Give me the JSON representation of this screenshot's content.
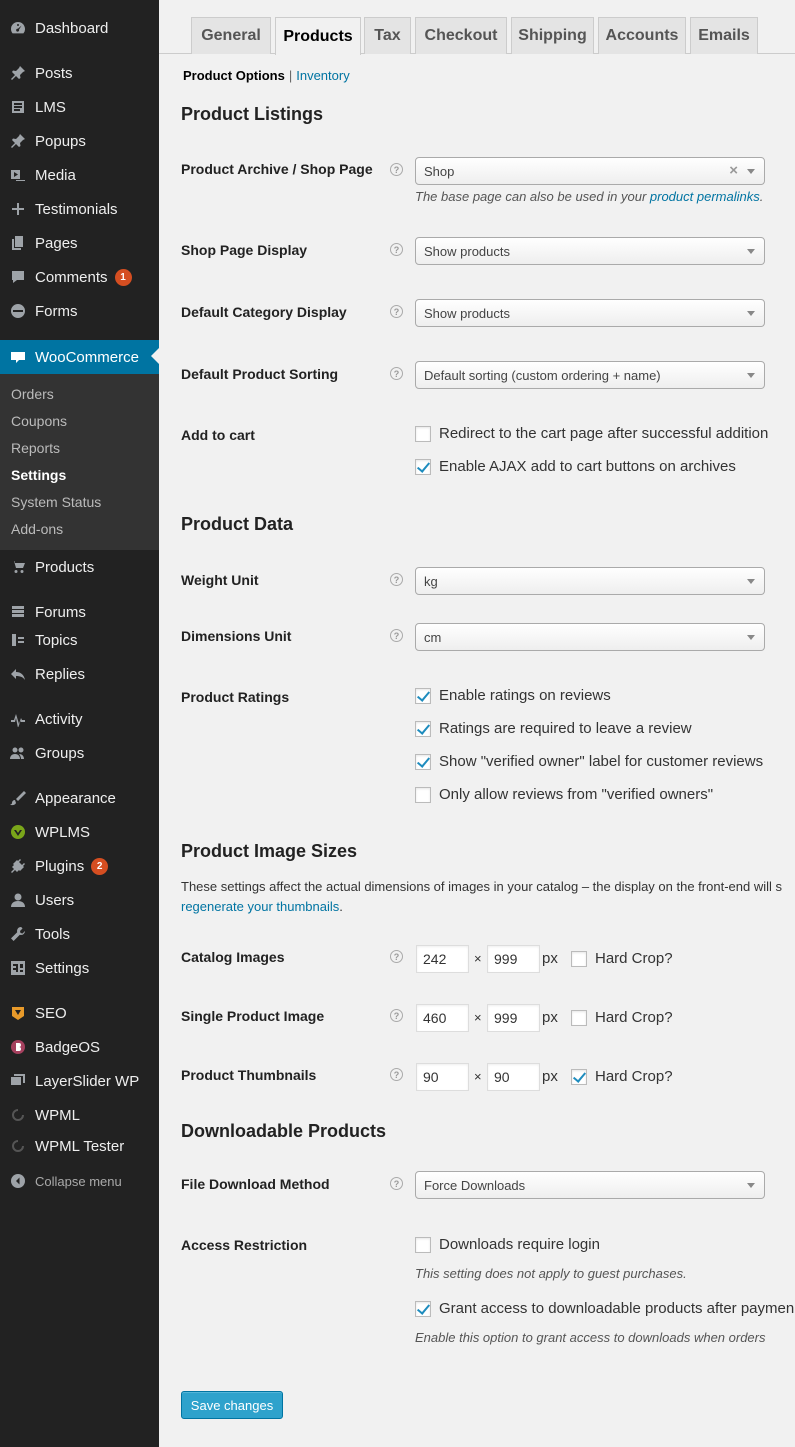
{
  "sidebar": {
    "items": [
      {
        "label": "Dashboard",
        "icon": "dashboard-icon"
      },
      {
        "label": "Posts",
        "icon": "pin-icon"
      },
      {
        "label": "LMS",
        "icon": "lms-icon"
      },
      {
        "label": "Popups",
        "icon": "pin-icon"
      },
      {
        "label": "Media",
        "icon": "media-icon"
      },
      {
        "label": "Testimonials",
        "icon": "plus-icon"
      },
      {
        "label": "Pages",
        "icon": "pages-icon"
      },
      {
        "label": "Comments",
        "icon": "comment-icon",
        "badge": "1"
      },
      {
        "label": "Forms",
        "icon": "forms-icon"
      },
      {
        "label": "WooCommerce",
        "icon": "woo-icon"
      },
      {
        "label": "Products",
        "icon": "cart-icon"
      },
      {
        "label": "Forums",
        "icon": "forums-icon"
      },
      {
        "label": "Topics",
        "icon": "topics-icon"
      },
      {
        "label": "Replies",
        "icon": "replies-icon"
      },
      {
        "label": "Activity",
        "icon": "activity-icon"
      },
      {
        "label": "Groups",
        "icon": "groups-icon"
      },
      {
        "label": "Appearance",
        "icon": "brush-icon"
      },
      {
        "label": "WPLMS",
        "icon": "wplms-icon"
      },
      {
        "label": "Plugins",
        "icon": "plug-icon",
        "badge": "2"
      },
      {
        "label": "Users",
        "icon": "user-icon"
      },
      {
        "label": "Tools",
        "icon": "wrench-icon"
      },
      {
        "label": "Settings",
        "icon": "settings-icon"
      },
      {
        "label": "SEO",
        "icon": "seo-icon"
      },
      {
        "label": "BadgeOS",
        "icon": "badgeos-icon"
      },
      {
        "label": "LayerSlider WP",
        "icon": "layers-icon"
      },
      {
        "label": "WPML",
        "icon": "wpml-icon"
      },
      {
        "label": "WPML Tester",
        "icon": "wpml-icon"
      }
    ],
    "submenu": [
      "Orders",
      "Coupons",
      "Reports",
      "Settings",
      "System Status",
      "Add-ons"
    ],
    "collapse": "Collapse menu"
  },
  "tabs": [
    "General",
    "Products",
    "Tax",
    "Checkout",
    "Shipping",
    "Accounts",
    "Emails"
  ],
  "subnav": {
    "current": "Product Options",
    "separator": "|",
    "link": "Inventory"
  },
  "sections": {
    "listings": "Product Listings",
    "data": "Product Data",
    "images": "Product Image Sizes",
    "downloads": "Downloadable Products"
  },
  "fields": {
    "shop_page": {
      "label": "Product Archive / Shop Page",
      "value": "Shop",
      "desc_prefix": "The base page can also be used in your ",
      "desc_link": "product permalinks",
      "desc_suffix": "."
    },
    "shop_display": {
      "label": "Shop Page Display",
      "value": "Show products"
    },
    "category_display": {
      "label": "Default Category Display",
      "value": "Show products"
    },
    "sorting": {
      "label": "Default Product Sorting",
      "value": "Default sorting (custom ordering + name)"
    },
    "add_to_cart": {
      "label": "Add to cart",
      "options": [
        {
          "text": "Redirect to the cart page after successful addition",
          "checked": false
        },
        {
          "text": "Enable AJAX add to cart buttons on archives",
          "checked": true
        }
      ]
    },
    "weight": {
      "label": "Weight Unit",
      "value": "kg"
    },
    "dimensions": {
      "label": "Dimensions Unit",
      "value": "cm"
    },
    "ratings": {
      "label": "Product Ratings",
      "options": [
        {
          "text": "Enable ratings on reviews",
          "checked": true
        },
        {
          "text": "Ratings are required to leave a review",
          "checked": true
        },
        {
          "text": "Show \"verified owner\" label for customer reviews",
          "checked": true
        },
        {
          "text": "Only allow reviews from \"verified owners\"",
          "checked": false
        }
      ]
    },
    "images_intro": "These settings affect the actual dimensions of images in your catalog – the display on the front-end will s",
    "images_intro_link": "regenerate your thumbnails",
    "images_intro_end": ".",
    "catalog": {
      "label": "Catalog Images",
      "width": "242",
      "height": "999",
      "crop": false
    },
    "single": {
      "label": "Single Product Image",
      "width": "460",
      "height": "999",
      "crop": false
    },
    "thumbs": {
      "label": "Product Thumbnails",
      "width": "90",
      "height": "90",
      "crop": true
    },
    "times": "×",
    "px": "px",
    "crop_label": "Hard Crop?",
    "download_method": {
      "label": "File Download Method",
      "value": "Force Downloads"
    },
    "access": {
      "label": "Access Restriction",
      "opt1": "Downloads require login",
      "opt1_checked": false,
      "desc1": "This setting does not apply to guest purchases.",
      "opt2": "Grant access to downloadable products after paymen",
      "opt2_checked": true,
      "desc2": "Enable this option to grant access to downloads when orders"
    }
  },
  "help_glyph": "?",
  "clear_glyph": "×",
  "save_label": "Save changes",
  "colors": {
    "sidebar_bg": "#222222",
    "accent": "#0074a2",
    "badge": "#d54e21",
    "button": "#2ea2cc"
  }
}
